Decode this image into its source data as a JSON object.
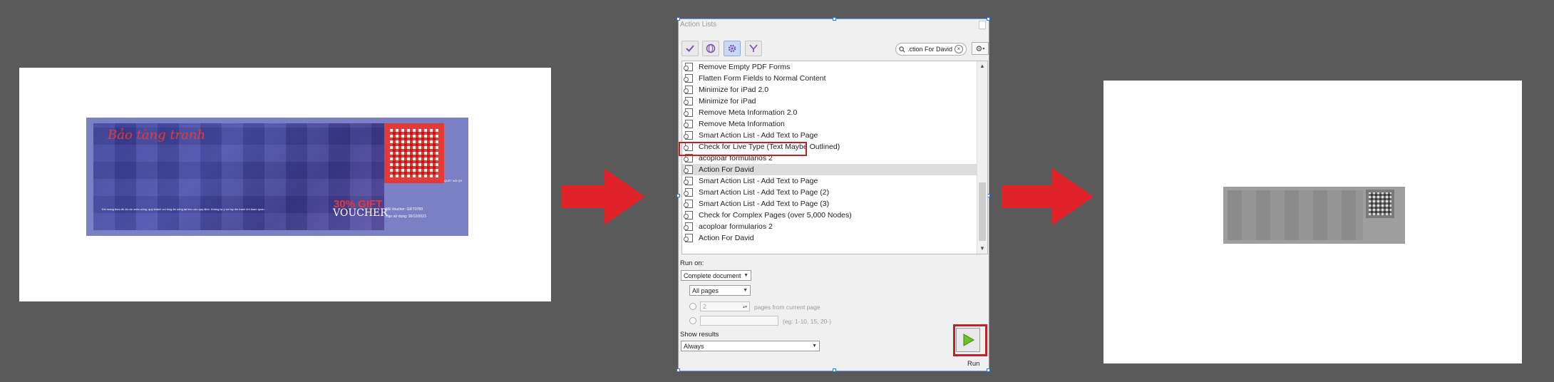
{
  "left_page": {
    "voucher": {
      "title": "Bảo tàng tranh",
      "discount": "30% GIFT",
      "word": "VOUCHER",
      "qr_label": "QUÉT MÃ QR",
      "fine_print": "Khi mang theo đồ ăn và nước uống, quý khách vui lòng ăn uống tại khu vực quy định. Không tự ý sờ tay lên tranh khi tham quan.",
      "code": "Mã Voucher: GIFT0789",
      "expiry": "Hạn sử dụng: 30/12/2023"
    }
  },
  "panel": {
    "title": "Action Lists",
    "toolbar": {
      "icons": [
        "check-icon",
        "globe-icon",
        "gear-icon",
        "filter-icon"
      ]
    },
    "search": {
      "value": ".ction For David"
    },
    "gear_menu_icon": "gear-icon",
    "items": [
      {
        "label": "Remove Empty PDF Forms"
      },
      {
        "label": "Flatten Form Fields to Normal Content"
      },
      {
        "label": "Minimize for iPad 2.0"
      },
      {
        "label": "Minimize for iPad"
      },
      {
        "label": "Remove Meta Information 2.0"
      },
      {
        "label": "Remove Meta Information"
      },
      {
        "label": "Smart Action List - Add Text to Page"
      },
      {
        "label": "Check for Live Type (Text Maybe Outlined)"
      },
      {
        "label": "acoploar formularios 2"
      },
      {
        "label": "Action For David"
      },
      {
        "label": "Smart Action List - Add Text to Page"
      },
      {
        "label": "Smart Action List - Add Text to Page (2)"
      },
      {
        "label": "Smart Action List - Add Text to Page (3)"
      },
      {
        "label": "Check for Complex Pages (over 5,000 Nodes)"
      },
      {
        "label": "acoploar formularios 2"
      },
      {
        "label": "Action For David"
      }
    ],
    "selected_index": 9,
    "run_on": {
      "label": "Run on:",
      "scope": "Complete document",
      "pages": "All pages",
      "pages_count": "2",
      "pages_from_label": "pages from current page",
      "range_hint": "(eg: 1-10, 15, 20-)"
    },
    "show_results": {
      "label": "Show results",
      "value": "Always"
    },
    "run_label": "Run"
  },
  "colors": {
    "background": "#5a5a5a",
    "arrow": "#e0222a",
    "highlight_box": "#c0202a",
    "voucher_bg": "#7b7fc4"
  }
}
